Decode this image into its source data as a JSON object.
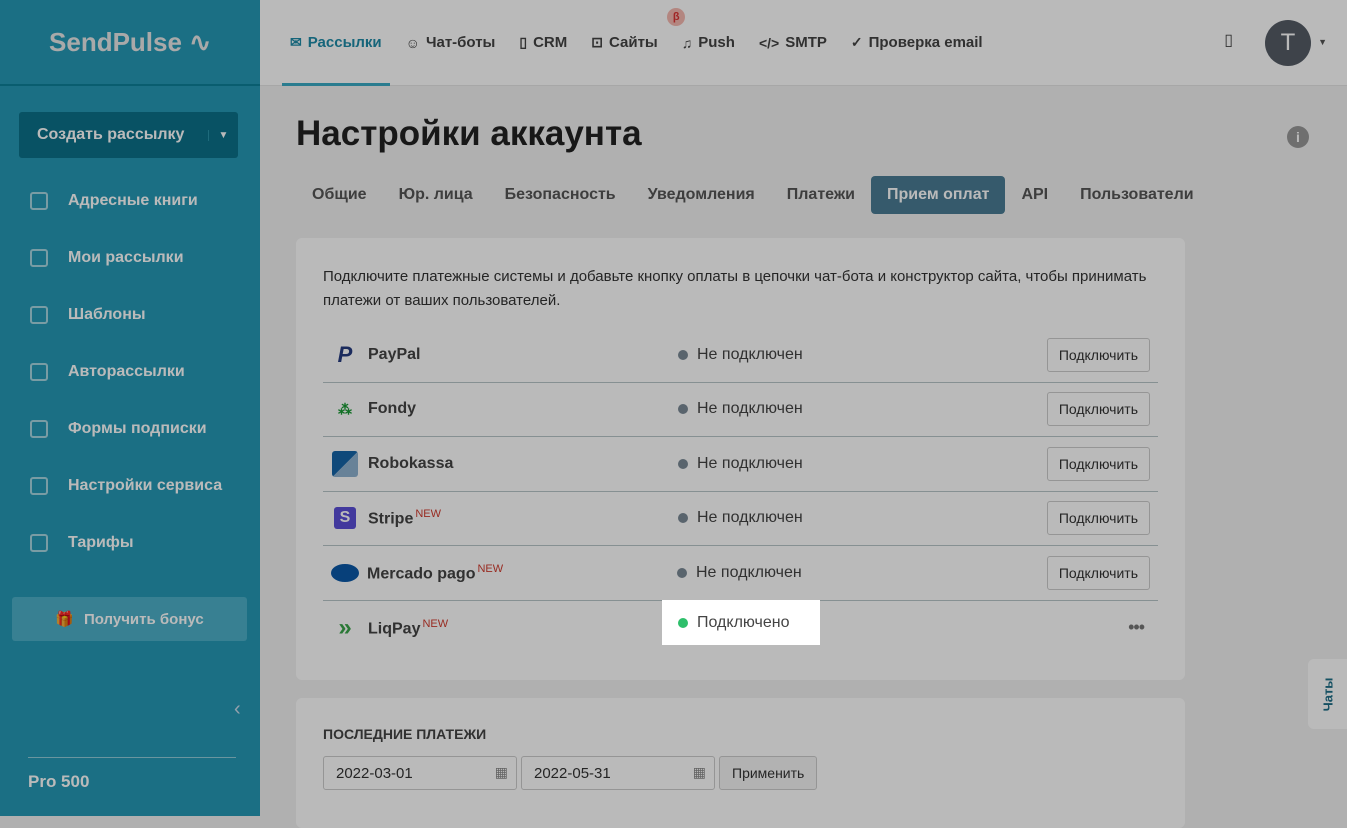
{
  "brand": "SendPulse",
  "sidebar": {
    "create": "Создать рассылку",
    "items": [
      {
        "label": "Адресные книги"
      },
      {
        "label": "Мои рассылки"
      },
      {
        "label": "Шаблоны"
      },
      {
        "label": "Авторассылки"
      },
      {
        "label": "Формы подписки"
      },
      {
        "label": "Настройки сервиса"
      },
      {
        "label": "Тарифы"
      }
    ],
    "bonus": "Получить бонус",
    "plan": "Pro 500"
  },
  "topnav": {
    "items": [
      {
        "label": "Рассылки",
        "icon": "✉"
      },
      {
        "label": "Чат-боты",
        "icon": "☺"
      },
      {
        "label": "CRM",
        "icon": "▯"
      },
      {
        "label": "Сайты",
        "icon": "⊡"
      },
      {
        "label": "Push",
        "icon": "♫"
      },
      {
        "label": "SMTP",
        "icon": "</>"
      },
      {
        "label": "Проверка email",
        "icon": "✓"
      }
    ],
    "beta": "β",
    "avatar": "T"
  },
  "page": {
    "title": "Настройки аккаунта",
    "tabs": [
      "Общие",
      "Юр. лица",
      "Безопасность",
      "Уведомления",
      "Платежи",
      "Прием оплат",
      "API",
      "Пользователи"
    ]
  },
  "payments": {
    "intro": "Подключите платежные системы и добавьте кнопку оплаты в цепочки чат-бота и конструктор сайта, чтобы принимать платежи от ваших пользователей.",
    "new_badge": "NEW",
    "connect": "Подключить",
    "more": "•••",
    "providers": [
      {
        "name": "PayPal",
        "status": "Не подключен"
      },
      {
        "name": "Fondy",
        "status": "Не подключен"
      },
      {
        "name": "Robokassa",
        "status": "Не подключен"
      },
      {
        "name": "Stripe",
        "status": "Не подключен"
      },
      {
        "name": "Mercado pago",
        "status": "Не подключен"
      },
      {
        "name": "LiqPay",
        "status": "Подключено"
      }
    ]
  },
  "recent": {
    "title": "ПОСЛЕДНИЕ ПЛАТЕЖИ",
    "from": "2022-03-01",
    "to": "2022-05-31",
    "apply": "Применить"
  },
  "chats": "Чаты"
}
